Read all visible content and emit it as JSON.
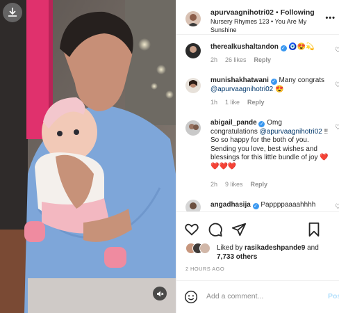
{
  "post": {
    "username": "apurvaagnihotri02",
    "follow_status": "Following",
    "dot": "•",
    "audio": "Nursery Rhymes 123 • You Are My Sunshine",
    "more_icon": "more-icon"
  },
  "comments": [
    {
      "username": "therealkushaltandon",
      "verified": true,
      "text": "🧿😍💫",
      "time": "2h",
      "likes": "26 likes",
      "reply": "Reply"
    },
    {
      "username": "munishakhatwani",
      "verified": true,
      "text": "Many congrats",
      "mention": "@apurvaagnihotri02",
      "emoji": "😍",
      "time": "1h",
      "likes": "1 like",
      "reply": "Reply"
    },
    {
      "username": "abigail_pande",
      "verified": true,
      "text": "Omg congratulations",
      "mention": "@apurvaagnihotri02",
      "text2": "!! So so happy for the both of you. Sending you love, best wishes and blessings for this little bundle of joy",
      "hearts": "❤️❤️❤️❤️",
      "time": "2h",
      "likes": "9 likes",
      "reply": "Reply"
    },
    {
      "username": "angadhasija",
      "verified": true,
      "text": "Pappppaaaahhhh"
    }
  ],
  "liked_by": {
    "prefix": "Liked by",
    "user": "rasikadeshpande9",
    "and": "and",
    "others": "7,733 others"
  },
  "timestamp": "2 HOURS AGO",
  "add_comment": {
    "placeholder": "Add a comment...",
    "post_label": "Post"
  },
  "icons": [
    "download-icon",
    "mute-icon",
    "heart-icon",
    "comment-icon",
    "share-icon",
    "bookmark-icon",
    "emoji-icon"
  ],
  "colors": {
    "accent": "#3897f0",
    "mention": "#00376b",
    "muted": "#8e8e8e",
    "post_disabled": "#b2dffc"
  }
}
